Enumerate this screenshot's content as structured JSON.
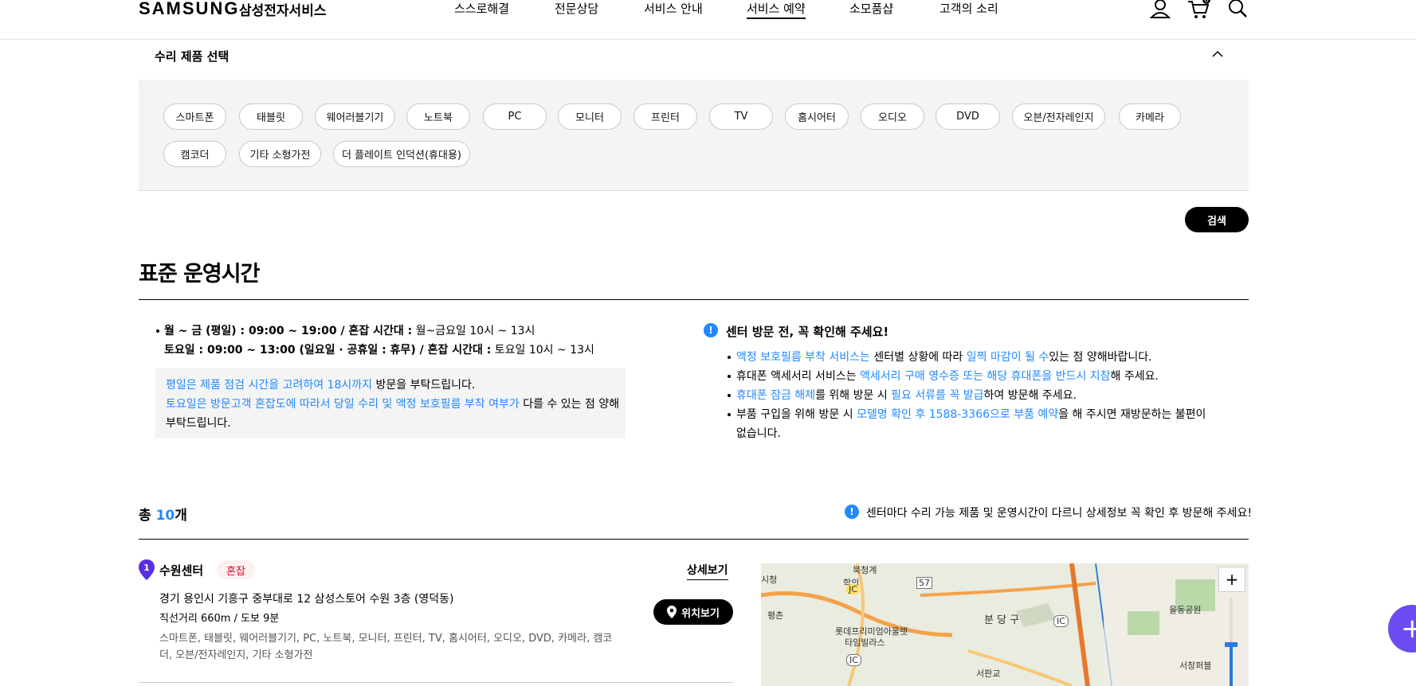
{
  "header": {
    "logo": "SAMSUNG",
    "logo_sub": "삼성전자서비스",
    "nav": [
      "스스로해결",
      "전문상담",
      "서비스 안내",
      "서비스 예약",
      "소모품샵",
      "고객의 소리"
    ],
    "active_nav": "서비스 예약",
    "cart_count": "0"
  },
  "product_select": {
    "title": "수리 제품 선택",
    "chips": [
      "스마트폰",
      "태블릿",
      "웨어러블기기",
      "노트북",
      "PC",
      "모니터",
      "프린터",
      "TV",
      "홈시어터",
      "오디오",
      "DVD",
      "오븐/전자레인지",
      "카메라",
      "캠코더",
      "기타 소형가전",
      "더 플레이트 인덕션(휴대용)"
    ],
    "search_label": "검색"
  },
  "hours": {
    "title": "표준 운영시간",
    "weekday_bold": "월 ~ 금 (평일) : 09:00 ~ 19:00 / 혼잡 시간대 :",
    "weekday_rest": " 월~금요일 10시 ~ 13시",
    "saturday_bold": "토요일 : 09:00 ~ 13:00 (일요일 · 공휴일 : 휴무) / 혼잡 시간대 :",
    "saturday_rest": " 토요일 10시 ~ 13시",
    "note1_blue": "평일은 제품 점검 시간을 고려하여 18시까지",
    "note1_rest": " 방문을 부탁드립니다.",
    "note2_blue": "토요일은 방문고객 혼잡도에 따라서 당일 수리 및 액정 보호필름 부착 여부가",
    "note2_rest": " 다를 수 있는 점 양해",
    "note3": "부탁드립니다."
  },
  "visit": {
    "title": "센터 방문 전, 꼭 확인해 주세요!",
    "items": [
      {
        "a": "액정 보호필름 부착 서비스는",
        "b": " 센터별 상황에 따라 ",
        "c": "일찍 마감이 될 수",
        "d": "있는 점 양해바랍니다."
      },
      {
        "a": "휴대폰 액세서리 서비스는 ",
        "b": "액세서리 구매 영수증 또는 해당 휴대폰을 반드시 지참",
        "c": "해 주세요."
      },
      {
        "a": "휴대폰 잠금 해제",
        "b": "를 위해 방문 시 ",
        "c": "필요 서류를 꼭 발급",
        "d": "하여 방문해 주세요."
      },
      {
        "a": "부품 구입을 위해 방문 시 ",
        "b": "모델명 확인 후 1588-3366으로 부품 예약",
        "c": "을 해 주시면 재방문하는 불편이",
        "d": "없습니다."
      }
    ]
  },
  "list": {
    "total_prefix": "총 ",
    "total_count": "10",
    "total_suffix": "개",
    "notice": "센터마다 수리 가능 제품 및 운영시간이 다르니 상세정보 꼭 확인 후 방문해 주세요!",
    "center": {
      "index": "1",
      "name": "수원센터",
      "badge": "혼잡",
      "detail_label": "상세보기",
      "address": "경기 용인시 기흥구 중부대로 12 삼성스토어 수원 3층 (영덕동)",
      "distance": "직선거리 660m / 도보 9분",
      "products": "스마트폰, 태블릿, 웨어러블기기, PC, 노트북, 모니터, 프린터, TV, 홈시어터, 오디오, DVD, 카메라, 캠코더, 오븐/전자레인지, 기타 소형가전",
      "location_label": "위치보기"
    }
  },
  "map": {
    "labels": [
      "북청계",
      "학의",
      "평촌",
      "롯데프리미엄아울렛",
      "타임빌라스",
      "분 당 구",
      "율동공원",
      "서판교",
      "서창퍼블",
      "57",
      "JC",
      "IC",
      "IC",
      "시청"
    ],
    "zoom_in": "+"
  }
}
